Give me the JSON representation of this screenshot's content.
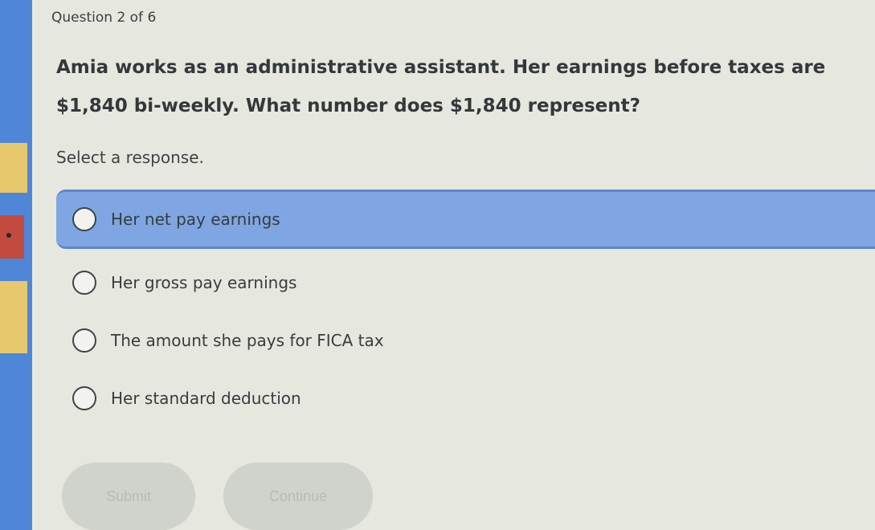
{
  "header": {
    "counter": "Question 2 of 6"
  },
  "question": {
    "line1": "Amia works as an administrative assistant. Her earnings before taxes are",
    "line2": "$1,840 bi-weekly. What number does $1,840 represent?"
  },
  "prompt": "Select a response.",
  "options": [
    {
      "label": "Her net pay earnings",
      "selected": true
    },
    {
      "label": "Her gross pay earnings",
      "selected": false
    },
    {
      "label": "The amount she pays for FICA tax",
      "selected": false
    },
    {
      "label": "Her standard deduction",
      "selected": false
    }
  ],
  "buttons": {
    "submit": "Submit",
    "continue": "Continue"
  },
  "colors": {
    "selected_option": "#7fa6e3",
    "rail": "#4f86d8",
    "button_disabled": "#cfd3cb"
  }
}
